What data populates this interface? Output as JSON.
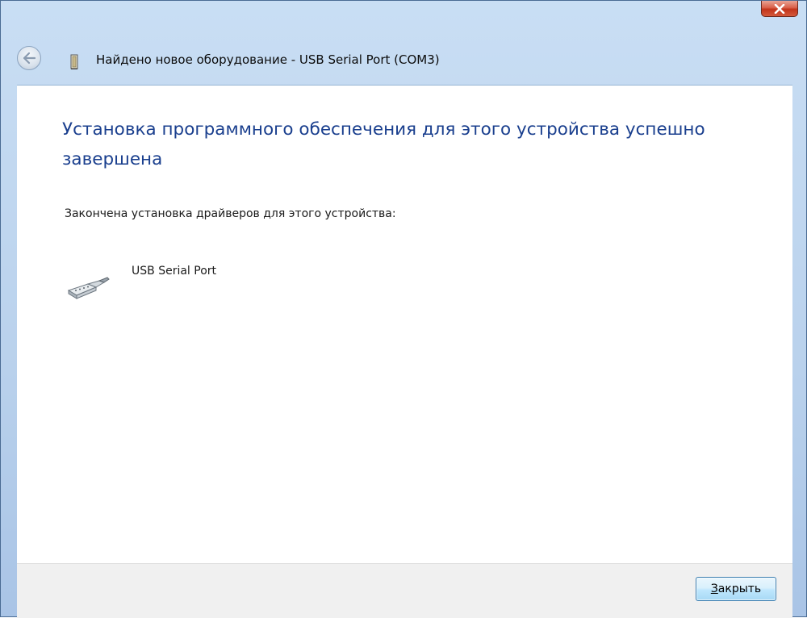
{
  "window": {
    "title": "Найдено новое оборудование - USB Serial Port (COM3)"
  },
  "content": {
    "heading": "Установка программного обеспечения для этого устройства успешно завершена",
    "subtext": "Закончена установка драйверов для этого устройства:",
    "device_name": "USB Serial Port"
  },
  "footer": {
    "close_button_accel": "З",
    "close_button_rest": "акрыть"
  },
  "icons": {
    "close": "close-icon",
    "back": "back-arrow-icon",
    "app": "hardware-icon",
    "device": "serial-port-icon"
  },
  "colors": {
    "heading": "#1a3f8e",
    "title_bar": "#b9d1ec",
    "close_button": "#c2341b",
    "footer_bg": "#f0f0f0"
  }
}
